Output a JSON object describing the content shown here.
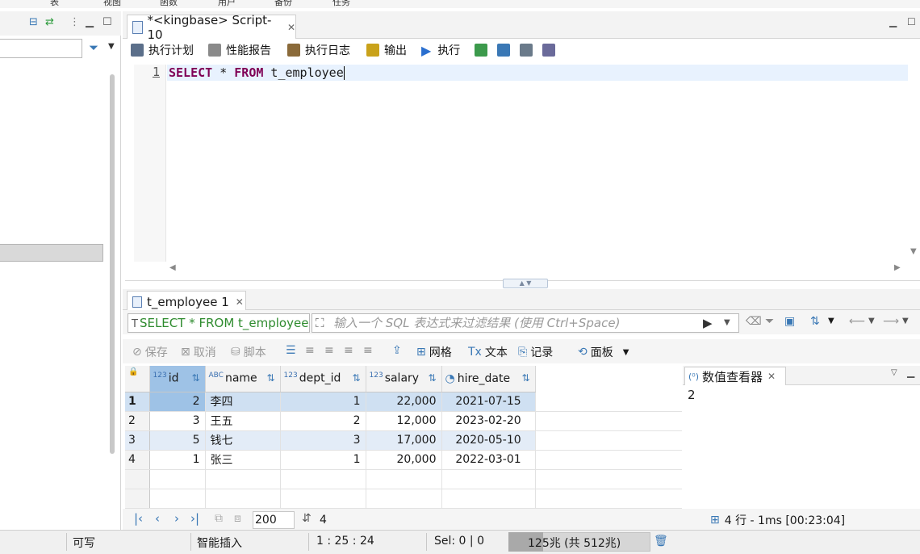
{
  "menubar": {
    "items": [
      "表",
      "视图",
      "函数",
      "用户",
      "备份",
      "任务"
    ]
  },
  "editor": {
    "tab_label": "*<kingbase> Script-10",
    "toolbar": {
      "plan": "执行计划",
      "perf_report": "性能报告",
      "exec_log": "执行日志",
      "output": "输出",
      "run": "执行"
    },
    "line_number": "1",
    "code": {
      "kw_select": "SELECT",
      "star": " * ",
      "kw_from": "FROM",
      "table": " t_employee"
    }
  },
  "results": {
    "tab_label": "t_employee 1",
    "filter_sql": "SELECT * FROM t_employee",
    "filter_placeholder": "输入一个 SQL 表达式来过滤结果 (使用 Ctrl+Space)",
    "toolbar": {
      "save": "保存",
      "cancel": "取消",
      "script": "脚本",
      "grid": "网格",
      "text": "文本",
      "record": "记录",
      "panel": "面板"
    },
    "columns": [
      {
        "type": "123",
        "name": "id"
      },
      {
        "type": "ABC",
        "name": "name"
      },
      {
        "type": "123",
        "name": "dept_id"
      },
      {
        "type": "123",
        "name": "salary"
      },
      {
        "type": "clock",
        "name": "hire_date"
      }
    ],
    "rows": [
      {
        "rn": "1",
        "id": "2",
        "name": "李四",
        "dept_id": "1",
        "salary": "22,000",
        "hire_date": "2021-07-15"
      },
      {
        "rn": "2",
        "id": "3",
        "name": "王五",
        "dept_id": "2",
        "salary": "12,000",
        "hire_date": "2023-02-20"
      },
      {
        "rn": "3",
        "id": "5",
        "name": "钱七",
        "dept_id": "3",
        "salary": "17,000",
        "hire_date": "2020-05-10"
      },
      {
        "rn": "4",
        "id": "1",
        "name": "张三",
        "dept_id": "1",
        "salary": "20,000",
        "hire_date": "2022-03-01"
      }
    ],
    "value_viewer": {
      "label": "数值查看器",
      "value": "2"
    },
    "pager": {
      "page_size": "200",
      "count": "4"
    },
    "exec_info": "4 行 - 1ms [00:23:04]"
  },
  "statusbar": {
    "writable": "可写",
    "insert_mode": "智能插入",
    "position": "1 : 25 : 24",
    "selection": "Sel: 0 | 0",
    "heap": "125兆 (共 512兆)",
    "heap_used_fraction": 0.244
  },
  "colors": {
    "keyword": "#7f0055",
    "selection": "#cfe0f2",
    "accent": "#3a78b5"
  }
}
